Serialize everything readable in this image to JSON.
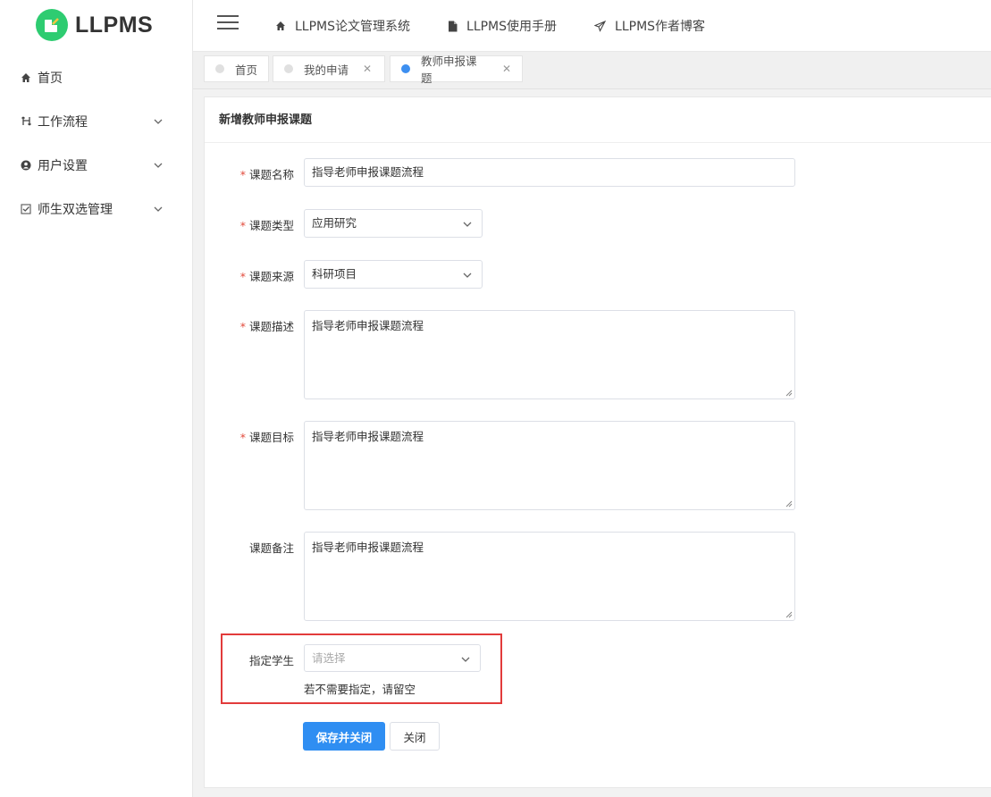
{
  "app": {
    "logo_text": "LLPMS"
  },
  "sidebar": {
    "items": [
      {
        "label": "首页",
        "icon": "home-icon"
      },
      {
        "label": "工作流程",
        "icon": "workflow-icon"
      },
      {
        "label": "用户设置",
        "icon": "user-icon"
      },
      {
        "label": "师生双选管理",
        "icon": "checkbox-icon"
      }
    ]
  },
  "topnav": {
    "items": [
      {
        "label": "LLPMS论文管理系统",
        "icon": "home-icon"
      },
      {
        "label": "LLPMS使用手册",
        "icon": "file-icon"
      },
      {
        "label": "LLPMS作者博客",
        "icon": "send-icon"
      }
    ]
  },
  "tabs": [
    {
      "label": "首页",
      "active": false,
      "closable": false
    },
    {
      "label": "我的申请",
      "active": false,
      "closable": true
    },
    {
      "label": "教师申报课题",
      "active": true,
      "closable": true
    }
  ],
  "tab_close_glyph": "✕",
  "form": {
    "title": "新增教师申报课题",
    "required_mark": "*",
    "fields": {
      "name": {
        "label": "课题名称",
        "value": "指导老师申报课题流程"
      },
      "type": {
        "label": "课题类型",
        "value": "应用研究"
      },
      "source": {
        "label": "课题来源",
        "value": "科研项目"
      },
      "description": {
        "label": "课题描述",
        "value": "指导老师申报课题流程"
      },
      "goal": {
        "label": "课题目标",
        "value": "指导老师申报课题流程"
      },
      "remark": {
        "label": "课题备注",
        "value": "指导老师申报课题流程"
      },
      "student": {
        "label": "指定学生",
        "placeholder": "请选择",
        "hint": "若不需要指定，请留空"
      }
    },
    "buttons": {
      "save": "保存并关闭",
      "close": "关闭"
    }
  },
  "colors": {
    "primary": "#2f8ef2",
    "logo": "#2ecc71",
    "required": "#e24a3b",
    "highlight": "#e23b3b"
  }
}
